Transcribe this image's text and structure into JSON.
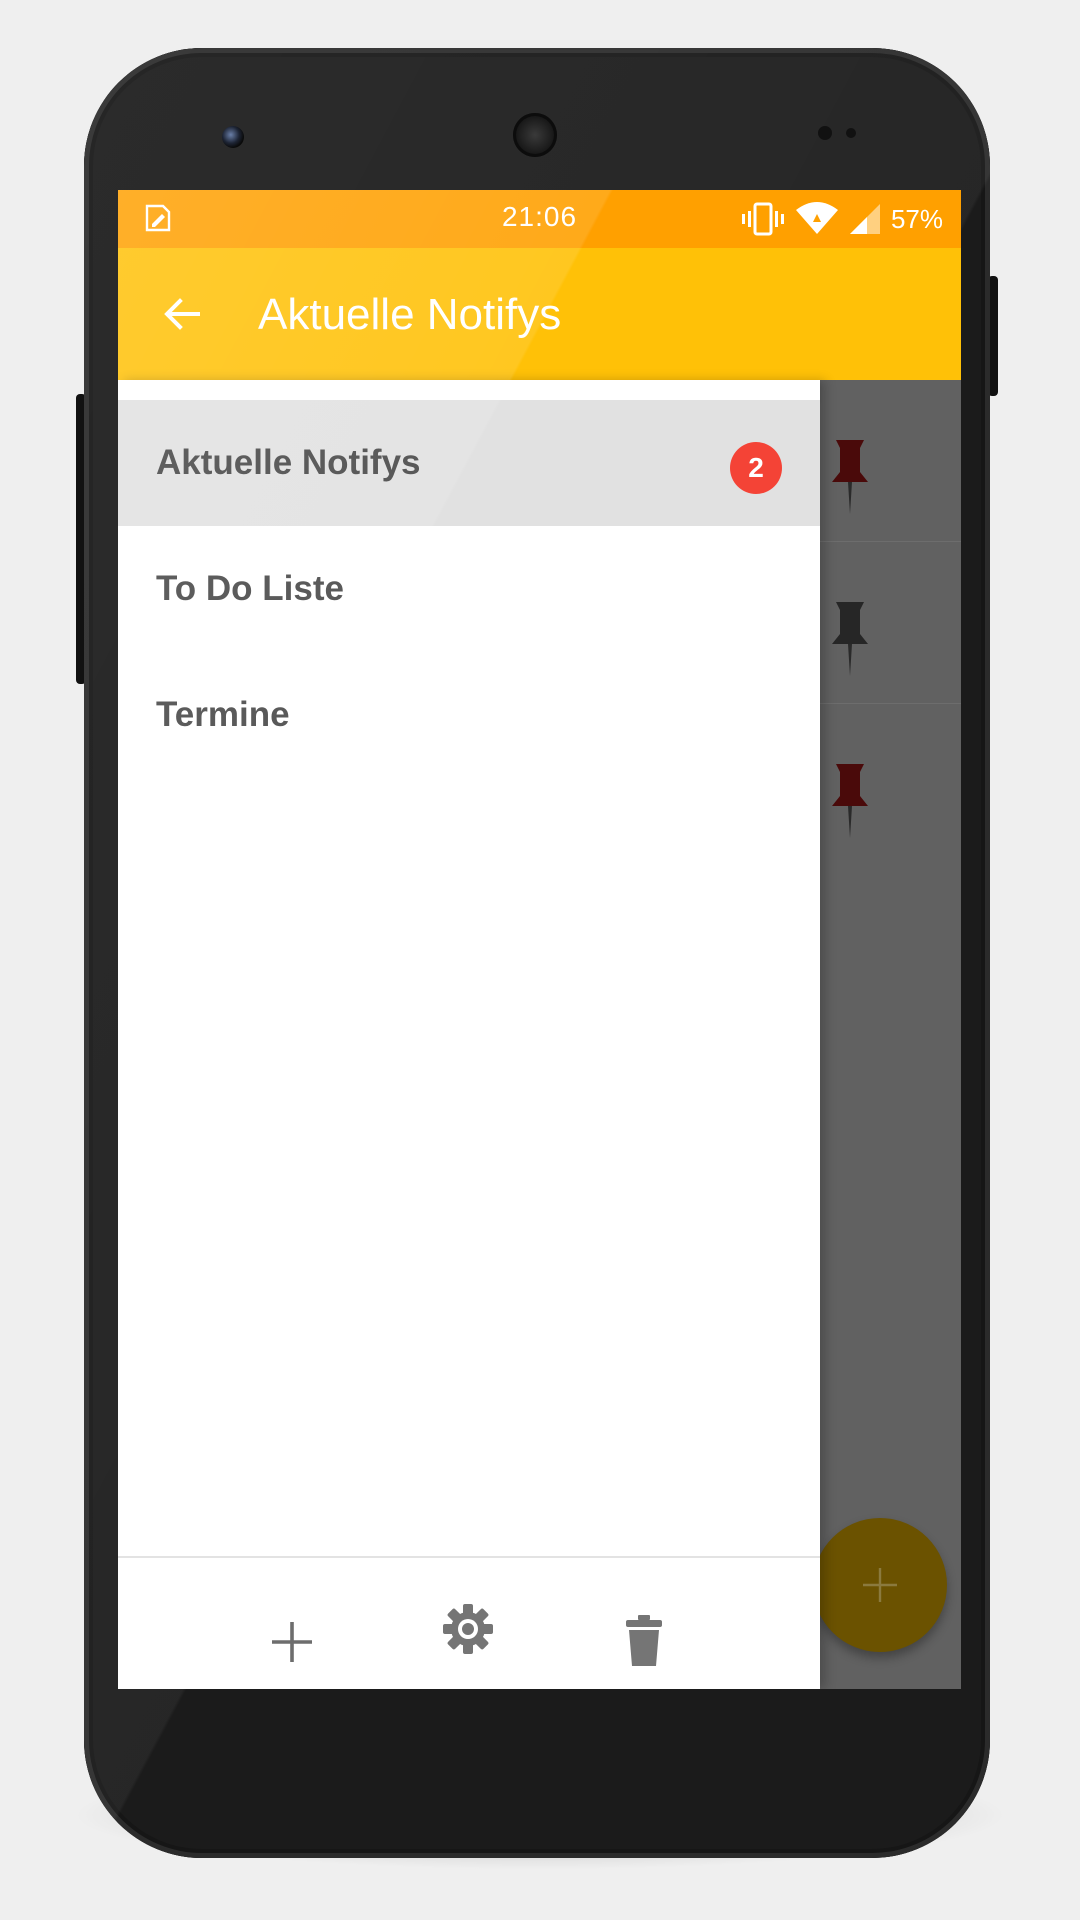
{
  "status_bar": {
    "time": "21:06",
    "battery": "57%",
    "icons": [
      "note-edit-icon",
      "vibrate-icon",
      "wifi-icon",
      "signal-icon"
    ]
  },
  "app_bar": {
    "title": "Aktuelle Notifys",
    "back_icon": "arrow-back-icon"
  },
  "drawer": {
    "items": [
      {
        "label": "Aktuelle Notifys",
        "badge": "2",
        "active": true
      },
      {
        "label": "To Do Liste"
      },
      {
        "label": "Termine"
      }
    ],
    "actions": [
      "add-icon",
      "trash-icon"
    ],
    "footer_icon": "gear-icon"
  },
  "background": {
    "pins": [
      "red",
      "black",
      "red"
    ],
    "fab_icon": "plus-icon"
  },
  "colors": {
    "status_bar": "#ffa000",
    "app_bar": "#ffc107",
    "badge": "#f44336",
    "active_item": "#e1e1e1",
    "text": "#454545"
  }
}
